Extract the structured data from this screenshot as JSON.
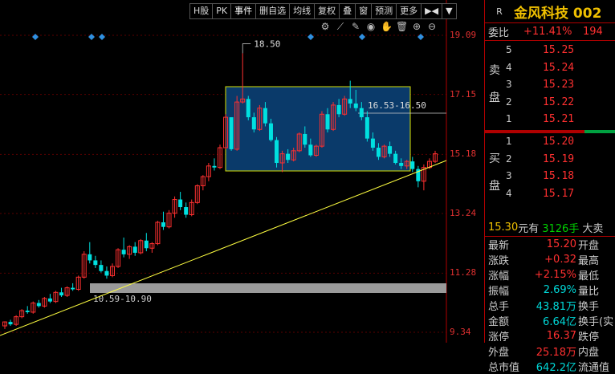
{
  "toolbar": {
    "items": [
      {
        "label": "H股"
      },
      {
        "label": "PK"
      },
      {
        "label": "事件"
      },
      {
        "label": "删自选"
      },
      {
        "label": "均线"
      },
      {
        "label": "复权"
      },
      {
        "label": "叠"
      },
      {
        "label": "窗"
      },
      {
        "label": "预测"
      },
      {
        "label": "更多"
      },
      {
        "label": "▶◀"
      },
      {
        "label": "▼"
      }
    ]
  },
  "chart_tools": {
    "icons": [
      "settings-icon",
      "pencil-icon",
      "pen-icon",
      "eye-icon",
      "hand-icon",
      "trash-icon",
      "zoom-in-icon",
      "zoom-out-icon"
    ],
    "glyphs": [
      "⚙",
      "⟋",
      "✎",
      "◉",
      "✋",
      "🗑",
      "⊕",
      "⊖"
    ]
  },
  "colors": {
    "up": "#ff3030",
    "down": "#00e0e0",
    "box_border": "#d8e000",
    "box_fill": "#0a3a6a",
    "trend_line": "#ffff40"
  },
  "chart_data": {
    "type": "candlestick",
    "y_axis": {
      "min": 9.34,
      "max": 19.09,
      "ticks": [
        "19.09",
        "17.15",
        "15.18",
        "13.24",
        "11.28",
        "9.34"
      ]
    },
    "annotations": {
      "high_label": "18.50",
      "range_label": "16.53-16.50",
      "support_label": "10.59-10.90"
    },
    "candles": [
      [
        9.55,
        9.7,
        9.45,
        9.68
      ],
      [
        9.68,
        9.75,
        9.55,
        9.6
      ],
      [
        9.6,
        9.9,
        9.55,
        9.85
      ],
      [
        9.85,
        10.1,
        9.8,
        10.05
      ],
      [
        10.05,
        10.2,
        9.95,
        10.0
      ],
      [
        10.0,
        10.35,
        9.95,
        10.3
      ],
      [
        10.3,
        10.4,
        10.15,
        10.2
      ],
      [
        10.2,
        10.5,
        10.15,
        10.45
      ],
      [
        10.45,
        10.6,
        10.3,
        10.35
      ],
      [
        10.35,
        10.7,
        10.3,
        10.65
      ],
      [
        10.65,
        10.8,
        10.5,
        10.55
      ],
      [
        10.55,
        10.85,
        10.5,
        10.8
      ],
      [
        10.8,
        10.95,
        10.7,
        10.75
      ],
      [
        10.75,
        11.2,
        10.7,
        11.15
      ],
      [
        11.15,
        12.0,
        11.1,
        11.9
      ],
      [
        11.9,
        12.3,
        11.6,
        11.7
      ],
      [
        11.7,
        11.85,
        11.45,
        11.55
      ],
      [
        11.55,
        11.7,
        11.3,
        11.35
      ],
      [
        11.35,
        11.5,
        11.1,
        11.2
      ],
      [
        11.2,
        11.6,
        11.15,
        11.5
      ],
      [
        11.5,
        12.1,
        11.45,
        12.05
      ],
      [
        12.05,
        12.45,
        11.8,
        11.9
      ],
      [
        11.9,
        12.2,
        11.75,
        12.15
      ],
      [
        12.15,
        12.3,
        11.85,
        11.95
      ],
      [
        11.95,
        12.4,
        11.9,
        12.35
      ],
      [
        12.35,
        12.6,
        12.0,
        12.1
      ],
      [
        12.1,
        12.3,
        11.95,
        12.25
      ],
      [
        12.25,
        13.0,
        12.2,
        12.95
      ],
      [
        12.95,
        13.3,
        12.7,
        12.8
      ],
      [
        12.8,
        13.35,
        12.75,
        13.25
      ],
      [
        13.25,
        13.8,
        13.1,
        13.7
      ],
      [
        13.7,
        13.95,
        13.35,
        13.45
      ],
      [
        13.45,
        13.6,
        13.1,
        13.2
      ],
      [
        13.2,
        13.7,
        13.15,
        13.6
      ],
      [
        13.6,
        14.2,
        13.55,
        14.15
      ],
      [
        14.15,
        14.5,
        14.0,
        14.45
      ],
      [
        14.45,
        14.9,
        14.3,
        14.8
      ],
      [
        14.8,
        15.05,
        14.65,
        14.75
      ],
      [
        14.75,
        15.5,
        14.7,
        15.4
      ],
      [
        15.4,
        16.5,
        15.35,
        16.4
      ],
      [
        16.4,
        16.2,
        15.3,
        15.35
      ],
      [
        15.35,
        17.1,
        15.3,
        16.9
      ],
      [
        16.9,
        18.5,
        16.85,
        17.0
      ],
      [
        17.0,
        17.1,
        16.3,
        16.4
      ],
      [
        16.4,
        16.55,
        15.9,
        16.0
      ],
      [
        16.0,
        16.8,
        15.95,
        16.7
      ],
      [
        16.7,
        16.9,
        16.1,
        16.2
      ],
      [
        16.2,
        16.35,
        15.6,
        15.65
      ],
      [
        15.65,
        15.75,
        14.75,
        14.9
      ],
      [
        14.9,
        15.3,
        14.6,
        15.2
      ],
      [
        15.2,
        15.35,
        14.9,
        15.0
      ],
      [
        15.0,
        15.4,
        14.95,
        15.3
      ],
      [
        15.3,
        15.9,
        15.25,
        15.85
      ],
      [
        15.85,
        16.1,
        15.4,
        15.5
      ],
      [
        15.5,
        15.7,
        15.1,
        15.15
      ],
      [
        15.15,
        15.5,
        15.1,
        15.45
      ],
      [
        15.45,
        16.6,
        15.4,
        16.5
      ],
      [
        16.5,
        16.7,
        15.9,
        16.0
      ],
      [
        16.0,
        16.9,
        15.95,
        16.8
      ],
      [
        16.8,
        17.0,
        16.4,
        16.5
      ],
      [
        16.5,
        17.1,
        16.45,
        17.0
      ],
      [
        17.0,
        17.6,
        16.7,
        16.85
      ],
      [
        16.85,
        17.3,
        16.6,
        16.7
      ],
      [
        16.7,
        16.9,
        16.3,
        16.4
      ],
      [
        16.4,
        16.6,
        15.6,
        15.7
      ],
      [
        15.7,
        15.9,
        15.3,
        15.4
      ],
      [
        15.4,
        15.55,
        15.0,
        15.1
      ],
      [
        15.1,
        15.5,
        15.05,
        15.45
      ],
      [
        15.45,
        15.6,
        15.1,
        15.2
      ],
      [
        15.2,
        15.3,
        14.85,
        14.9
      ],
      [
        14.9,
        15.05,
        14.7,
        14.8
      ],
      [
        14.8,
        15.0,
        14.7,
        14.95
      ],
      [
        14.95,
        15.1,
        14.6,
        14.7
      ],
      [
        14.7,
        14.8,
        14.1,
        14.3
      ],
      [
        14.3,
        14.85,
        14.0,
        14.75
      ],
      [
        14.75,
        15.05,
        14.7,
        14.95
      ],
      [
        14.95,
        15.3,
        14.9,
        15.2
      ]
    ]
  },
  "panel": {
    "r_badge": "R",
    "stock_name": "金风科技 002",
    "webi": {
      "label": "委比",
      "pct": "+11.41%",
      "vol": "194"
    },
    "sell_side": "卖盘",
    "buy_side": "买盘",
    "asks": [
      {
        "lv": "5",
        "price": "15.25"
      },
      {
        "lv": "4",
        "price": "15.24"
      },
      {
        "lv": "3",
        "price": "15.23"
      },
      {
        "lv": "2",
        "price": "15.22"
      },
      {
        "lv": "1",
        "price": "15.21"
      }
    ],
    "bids": [
      {
        "lv": "1",
        "price": "15.20"
      },
      {
        "lv": "2",
        "price": "15.19"
      },
      {
        "lv": "3",
        "price": "15.18"
      },
      {
        "lv": "4",
        "price": "15.17"
      }
    ],
    "last_trade": {
      "price": "15.30",
      "unit": "元有",
      "vol": "3126手",
      "tail": "大卖"
    },
    "stats": [
      {
        "k": "最新",
        "v": "15.20",
        "vclass": "red",
        "k2": "开盘"
      },
      {
        "k": "涨跌",
        "v": "+0.32",
        "vclass": "red",
        "k2": "最高"
      },
      {
        "k": "涨幅",
        "v": "+2.15%",
        "vclass": "red",
        "k2": "最低"
      },
      {
        "k": "振幅",
        "v": "2.69%",
        "vclass": "cyan",
        "k2": "量比"
      },
      {
        "k": "总手",
        "v": "43.81万",
        "vclass": "cyan",
        "k2": "换手"
      },
      {
        "k": "金额",
        "v": "6.64亿",
        "vclass": "cyan",
        "k2": "换手(实"
      },
      {
        "k": "涨停",
        "v": "16.37",
        "vclass": "red",
        "k2": "跌停"
      },
      {
        "k": "外盘",
        "v": "25.18万",
        "vclass": "red",
        "k2": "内盘"
      },
      {
        "k": "总市值",
        "v": "642.2亿",
        "vclass": "cyan",
        "k2": "流通值"
      }
    ]
  }
}
